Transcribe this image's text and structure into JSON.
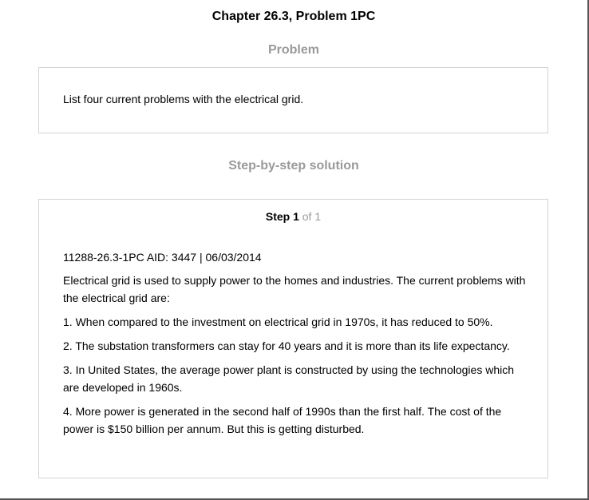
{
  "chapter_title": "Chapter 26.3, Problem 1PC",
  "problem": {
    "heading": "Problem",
    "text": "List four current problems with the electrical grid."
  },
  "solution": {
    "heading": "Step-by-step solution",
    "step_label": "Step 1",
    "step_of": " of 1",
    "meta": "11288-26.3-1PC AID: 3447 | 06/03/2014",
    "paragraphs": [
      "Electrical grid is used to supply power to the homes and industries. The current problems with the electrical grid are:",
      "1. When compared to the investment on electrical grid in 1970s, it has reduced to 50%.",
      "2. The substation transformers can stay for 40 years and it is more than its life expectancy.",
      "3. In United States, the average power plant is constructed by using the technologies which are developed in 1960s.",
      "4. More power is generated in the second half of 1990s than the first half. The cost of the power is $150 billion per annum. But this is getting disturbed."
    ]
  }
}
